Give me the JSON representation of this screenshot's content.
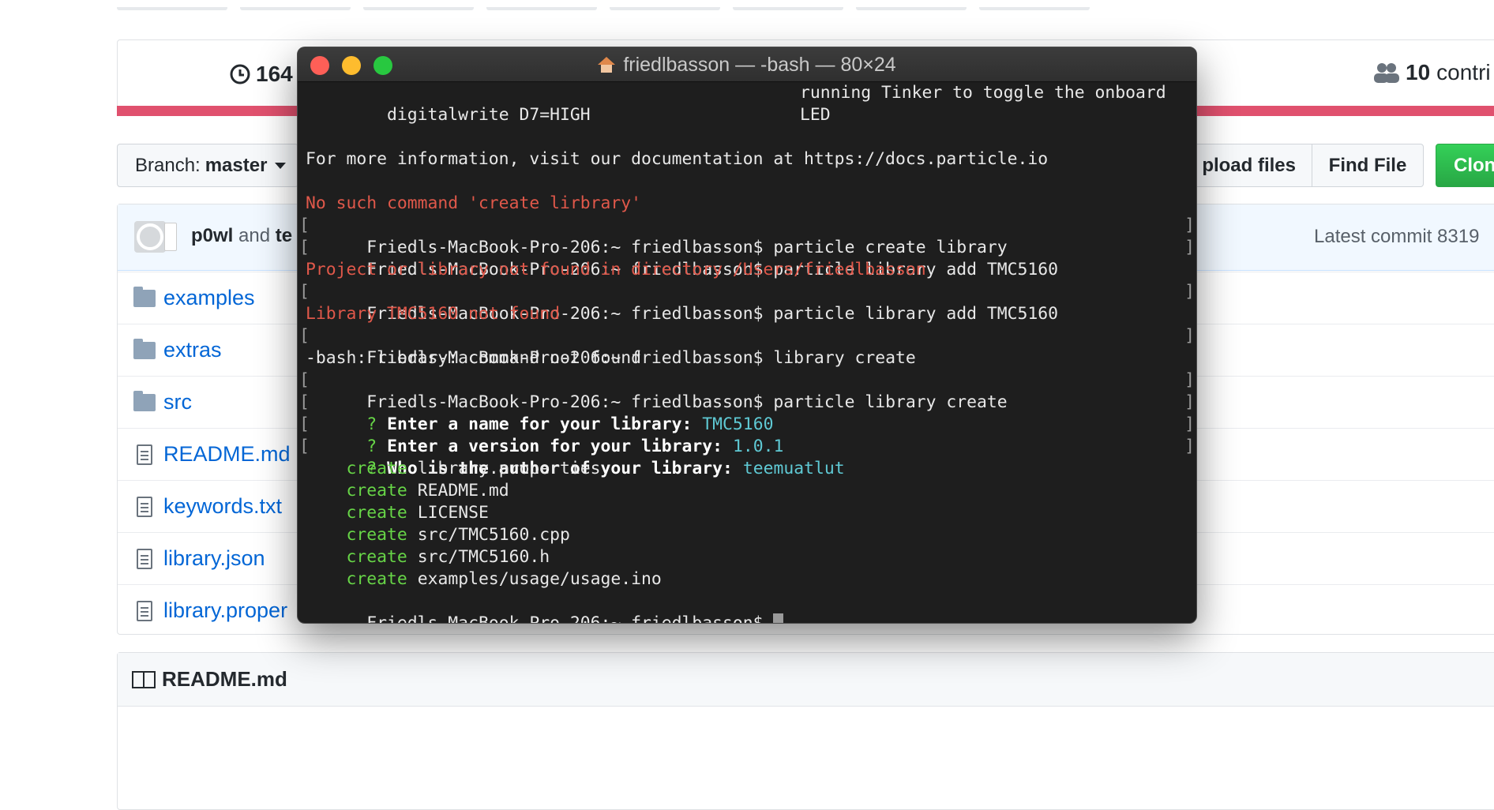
{
  "github": {
    "commits_count": "164",
    "contributors_count": "10",
    "contributors_label": "contri",
    "branch_label": "Branch:",
    "branch_name": "master",
    "upload_files": "pload files",
    "find_file": "Find File",
    "clone": "Clon",
    "commit_author": "p0wl",
    "commit_and": "and",
    "commit_other": "te",
    "latest_commit": "Latest commit 8319",
    "files": [
      {
        "type": "folder",
        "name": "examples"
      },
      {
        "type": "folder",
        "name": "extras"
      },
      {
        "type": "folder",
        "name": "src"
      },
      {
        "type": "file",
        "name": "README.md"
      },
      {
        "type": "file",
        "name": "keywords.txt"
      },
      {
        "type": "file",
        "name": "library.json"
      },
      {
        "type": "file",
        "name": "library.proper"
      }
    ],
    "readme_title": "README.md",
    "accent_color": "#e0516e"
  },
  "terminal": {
    "title": "friedlbasson — -bash — 80×24",
    "prompt": "Friedls-MacBook-Pro-206:~ friedlbasson$ ",
    "lines": {
      "l1a": "  digitalwrite D7=HIGH",
      "l1b": "running Tinker to toggle the onboard",
      "l2b": "LED",
      "l4": "For more information, visit our documentation at https://docs.particle.io",
      "l6": "No such command 'create lirbrary'",
      "l7_cmd": "particle create library",
      "l8_cmd": "particle library add TMC5160",
      "l9": "Project or library not found in directory /Users/friedlbasson",
      "l10_cmd": "particle library add TMC5160",
      "l11": "Library TMC5160 not found",
      "l12_cmd": "library create",
      "l13": "-bash: library: command not found",
      "l14_cmd": "particle library create",
      "q1": "Enter a name for your library: ",
      "q1_ans": "TMC5160",
      "q2": "Enter a version for your library: ",
      "q2_ans": "1.0.1",
      "q3": "Who is the author of your library: ",
      "q3_ans": "teemuatlut",
      "create_word": "create",
      "created": [
        "library.properties",
        "README.md",
        "LICENSE",
        "src/TMC5160.cpp",
        "src/TMC5160.h",
        "examples/usage/usage.ino"
      ]
    }
  }
}
